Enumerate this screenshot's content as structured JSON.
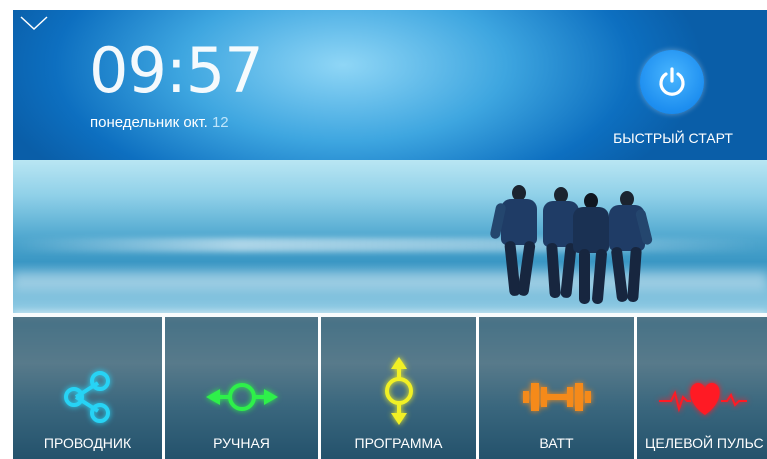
{
  "clock": {
    "hours": "09",
    "separator": ":",
    "minutes": "57"
  },
  "date": {
    "weekday_month": "понедельник окт.",
    "day": "12"
  },
  "quick_start": {
    "label": "БЫСТРЫЙ СТАРТ",
    "icon": "power-icon",
    "color": "#1d8ef0"
  },
  "menu": {
    "icon": "chevron-down-icon"
  },
  "modes": [
    {
      "label": "ПРОВОДНИК",
      "icon": "share-nodes-icon",
      "color": "#27d3f5"
    },
    {
      "label": "РУЧНАЯ",
      "icon": "horizontal-arrows-icon",
      "color": "#2ef04a"
    },
    {
      "label": "ПРОГРАММА",
      "icon": "vertical-arrows-icon",
      "color": "#f1f025"
    },
    {
      "label": "ВАТТ",
      "icon": "dumbbell-icon",
      "color": "#f58a1a"
    },
    {
      "label": "ЦЕЛЕВОЙ ПУЛЬС",
      "icon": "heart-pulse-icon",
      "color": "#ff1a24"
    }
  ]
}
